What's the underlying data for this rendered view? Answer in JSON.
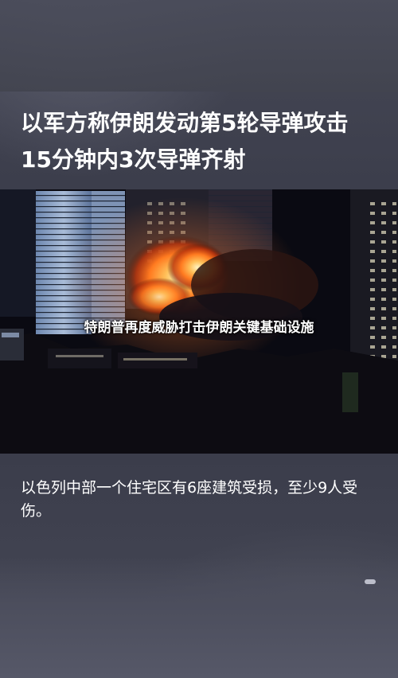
{
  "article": {
    "headline": "以军方称伊朗发动第5轮导弹攻击 15分钟内3次导弹齐射",
    "image_caption": "特朗普再度威胁打击伊朗关键基础设施",
    "body": "以色列中部一个住宅区有6座建筑受损，至少9人受伤。"
  },
  "colors": {
    "background": "#3f4150",
    "text": "#ffffff",
    "fire": "#ff8a2a"
  }
}
